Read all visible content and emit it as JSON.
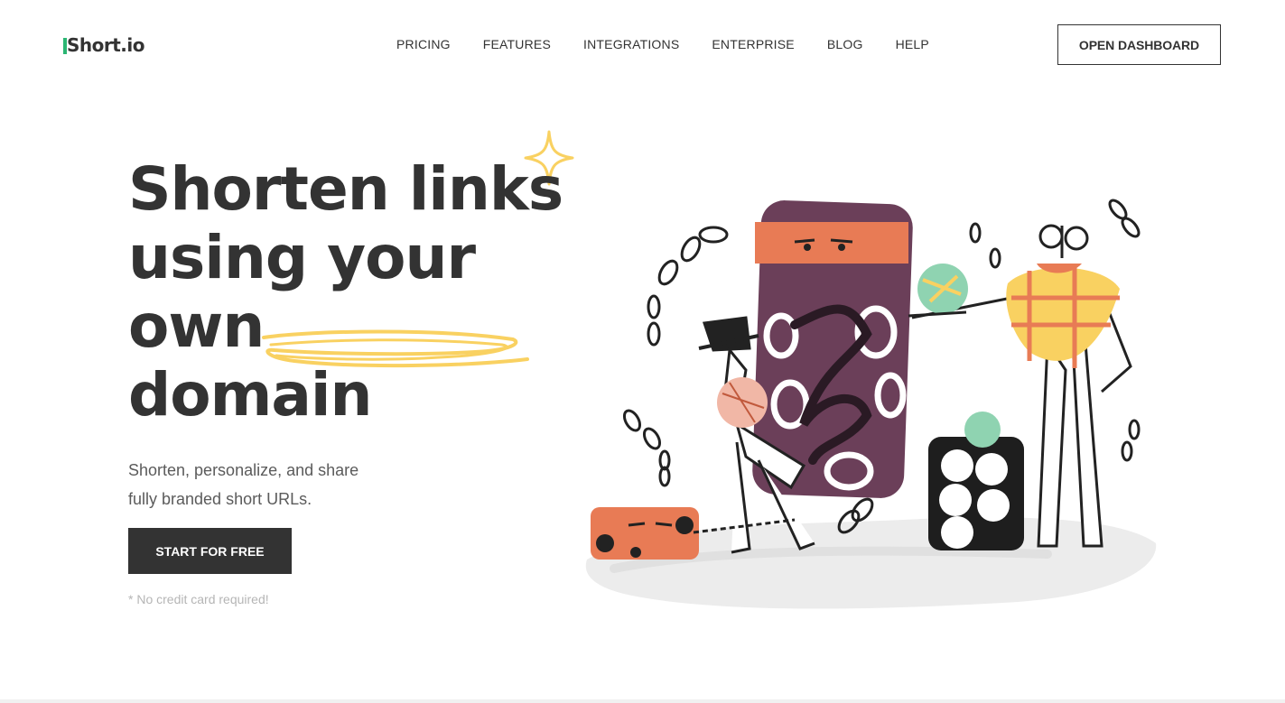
{
  "brand": {
    "name": "Short.io",
    "logo_text": "hort.io",
    "logo_letter": "S",
    "accent_color": "#2bb673",
    "text_color": "#333333"
  },
  "nav": {
    "items": [
      {
        "label": "PRICING"
      },
      {
        "label": "FEATURES"
      },
      {
        "label": "INTEGRATIONS"
      },
      {
        "label": "ENTERPRISE"
      },
      {
        "label": "BLOG"
      },
      {
        "label": "HELP"
      }
    ]
  },
  "header": {
    "dashboard_label": "OPEN DASHBOARD"
  },
  "hero": {
    "headline_line1": "Shorten links",
    "headline_line2": "using your",
    "headline_line3_prefix": "own ",
    "headline_highlight": "domain",
    "highlight_color": "#f9d161",
    "subtitle_line1": "Shorten, personalize, and share",
    "subtitle_line2": "fully branded short URLs.",
    "cta_label": "START FOR FREE",
    "note": "* No credit card required!"
  },
  "icons": {
    "sparkle": "sparkle-icon",
    "illustration": "characters-illustration"
  }
}
